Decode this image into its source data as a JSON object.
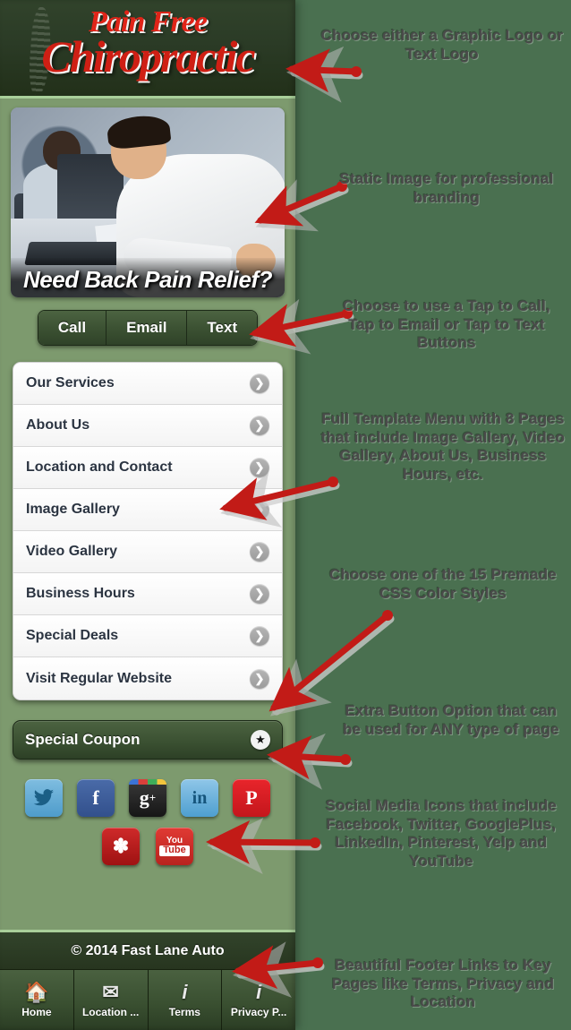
{
  "app": {
    "logo": {
      "line1": "Pain Free",
      "line2": "Chiropractic"
    },
    "hero": {
      "caption": "Need Back Pain Relief?"
    },
    "contact_buttons": [
      {
        "label": "Call",
        "name": "call-button"
      },
      {
        "label": "Email",
        "name": "email-button"
      },
      {
        "label": "Text",
        "name": "text-button"
      }
    ],
    "menu": [
      {
        "label": "Our Services"
      },
      {
        "label": "About Us"
      },
      {
        "label": "Location and Contact"
      },
      {
        "label": "Image Gallery"
      },
      {
        "label": "Video Gallery"
      },
      {
        "label": "Business Hours"
      },
      {
        "label": "Special Deals"
      },
      {
        "label": "Visit Regular Website"
      }
    ],
    "coupon": {
      "label": "Special Coupon",
      "badge_icon": "star-icon"
    },
    "social": [
      {
        "name": "twitter-icon",
        "glyph": "\u0001",
        "label": "Twitter"
      },
      {
        "name": "facebook-icon",
        "glyph": "f",
        "label": "Facebook"
      },
      {
        "name": "googleplus-icon",
        "glyph": "g+",
        "label": "GooglePlus"
      },
      {
        "name": "linkedin-icon",
        "glyph": "in",
        "label": "LinkedIn"
      },
      {
        "name": "pinterest-icon",
        "glyph": "P",
        "label": "Pinterest"
      },
      {
        "name": "yelp-icon",
        "glyph": "✽",
        "label": "Yelp"
      },
      {
        "name": "youtube-icon",
        "glyph": "You Tube",
        "label": "YouTube"
      }
    ],
    "footer": {
      "copyright": "© 2014 Fast Lane Auto",
      "tabs": [
        {
          "label": "Home",
          "icon": "home-icon"
        },
        {
          "label": "Location ...",
          "icon": "mail-icon"
        },
        {
          "label": "Terms",
          "icon": "info-icon"
        },
        {
          "label": "Privacy P...",
          "icon": "info-icon"
        }
      ]
    }
  },
  "annotations": [
    {
      "id": "a1",
      "text": "Choose either a Graphic Logo or Text Logo"
    },
    {
      "id": "a2",
      "text": "Static Image for professional branding"
    },
    {
      "id": "a3",
      "text": "Choose to use a Tap to Call, Tap to Email or Tap to Text Buttons"
    },
    {
      "id": "a4",
      "text": "Full Template Menu with 8 Pages that include Image Gallery, Video Gallery, About Us, Business Hours, etc."
    },
    {
      "id": "a5",
      "text": "Choose one of the 15 Premade CSS Color Styles"
    },
    {
      "id": "a6",
      "text": "Extra Button Option that can be used for ANY type of page"
    },
    {
      "id": "a7",
      "text": "Social Media Icons that include Facebook, Twitter, GooglePlus, LinkedIn, Pinterest, Yelp and YouTube"
    },
    {
      "id": "a8",
      "text": "Beautiful Footer Links to Key Pages like Terms, Privacy and Location"
    }
  ],
  "colors": {
    "background": "#4a7050",
    "phone_body": "#7d9a6e",
    "header_dark": "#2d3f28",
    "accent_red": "#cf1f14",
    "arrow_red": "#c21b17",
    "button_green": "#3b5132"
  }
}
